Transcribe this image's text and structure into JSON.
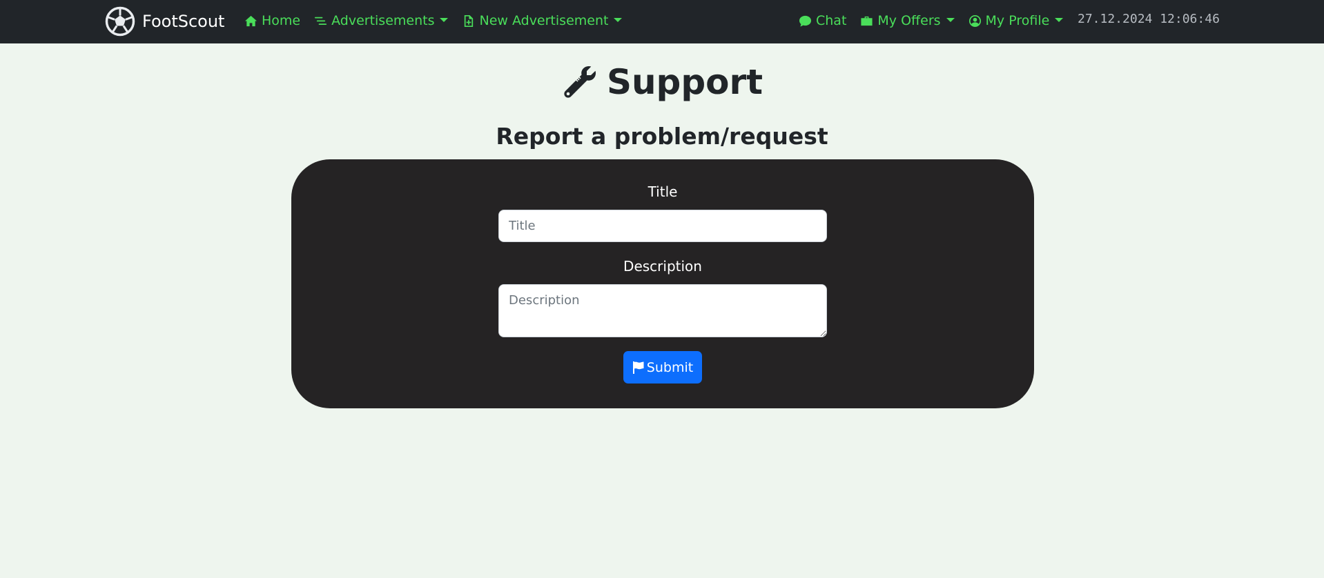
{
  "navbar": {
    "brand": "FootScout",
    "brand_icon": "soccer-ball-icon",
    "links": {
      "home": "Home",
      "advertisements": "Advertisements",
      "new_advertisement": "New Advertisement",
      "chat": "Chat",
      "my_offers": "My Offers",
      "my_profile": "My Profile"
    },
    "datetime": "27.12.2024 12:06:46",
    "link_color": "#4ade5a",
    "background": "#212529"
  },
  "page": {
    "title": "Support",
    "title_icon": "wrench-icon",
    "subtitle": "Report a problem/request",
    "background": "#eef5ee"
  },
  "form": {
    "title_label": "Title",
    "title_placeholder": "Title",
    "title_value": "",
    "description_label": "Description",
    "description_placeholder": "Description",
    "description_value": "",
    "submit_label": "Submit",
    "submit_icon": "flag-icon",
    "submit_color": "#0d6efd",
    "card_color": "#252324"
  }
}
